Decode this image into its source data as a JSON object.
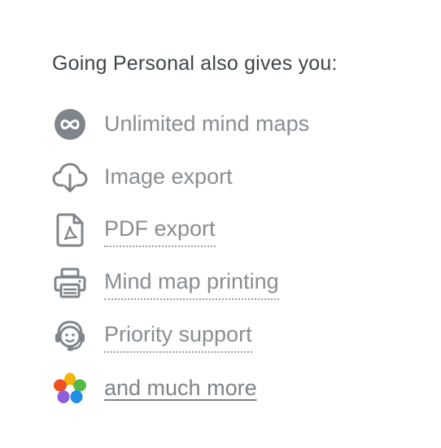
{
  "heading": "Going Personal also gives you:",
  "colors": {
    "heading": "#3f4549",
    "text": "#888d91",
    "icon": "#7f858a"
  },
  "features": [
    {
      "icon": "infinity-icon",
      "label": "Unlimited mind maps"
    },
    {
      "icon": "cloud-download-icon",
      "label": "Image export"
    },
    {
      "icon": "pdf-file-icon",
      "label": "PDF export"
    },
    {
      "icon": "printer-icon",
      "label": "Mind map printing"
    },
    {
      "icon": "headset-icon",
      "label": "Priority support"
    },
    {
      "icon": "colorful-flower-icon",
      "label": "and much more"
    }
  ]
}
